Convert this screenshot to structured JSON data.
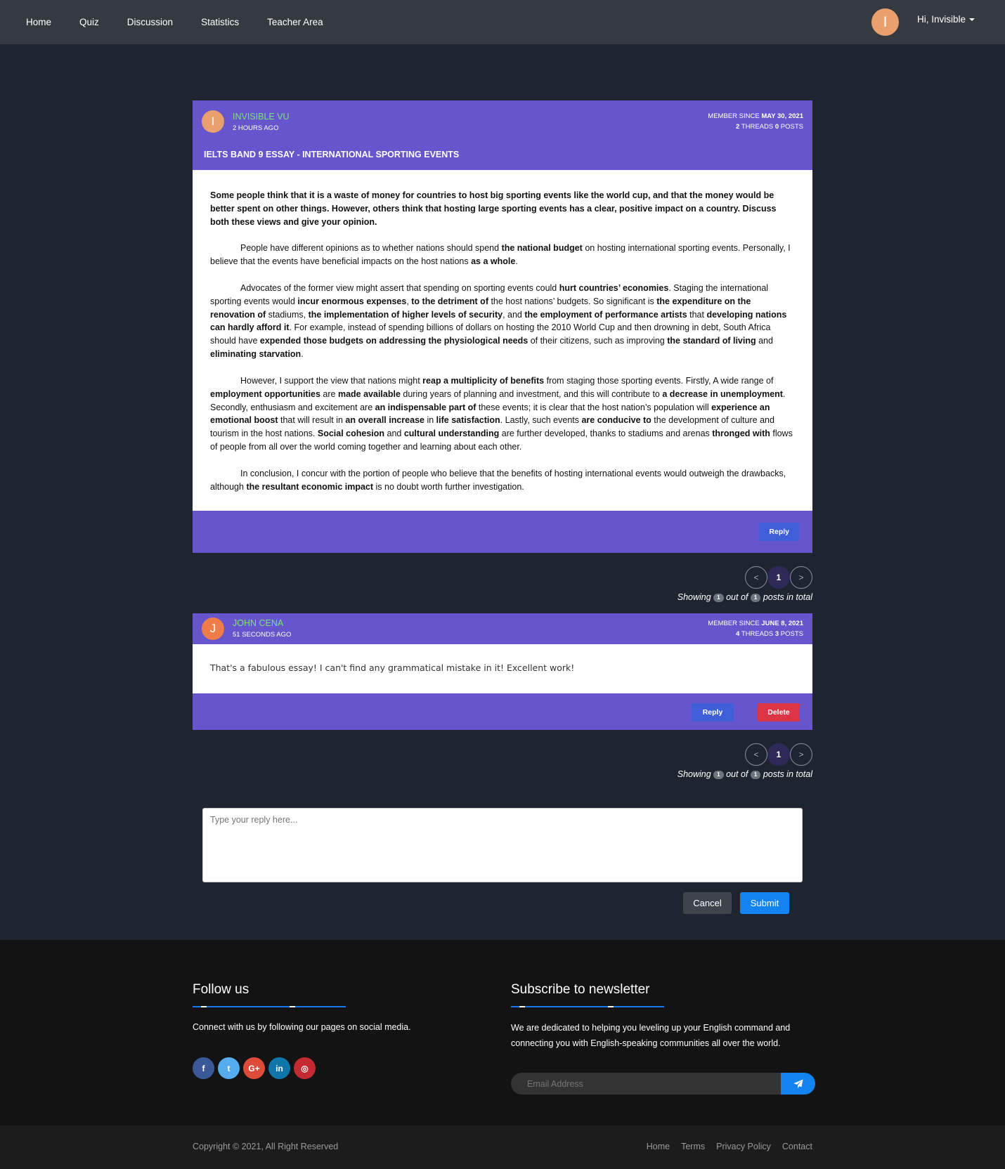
{
  "nav": {
    "links": [
      "Home",
      "Quiz",
      "Discussion",
      "Statistics",
      "Teacher Area"
    ],
    "avatar_letter": "I",
    "user_greeting": "Hi, Invisible"
  },
  "thread": {
    "avatar_letter": "I",
    "author": "INVISIBLE VU",
    "ago": "2 HOURS AGO",
    "member_since_label": "MEMBER SINCE",
    "member_since": "MAY 30, 2021",
    "threads_count": "2",
    "threads_label": "THREADS",
    "posts_count": "0",
    "posts_label": "POSTS",
    "title": "IELTS BAND 9 ESSAY - INTERNATIONAL SPORTING EVENTS",
    "reply_label": "Reply",
    "paragraphs": [
      [
        {
          "b": true,
          "t": "Some people think that it is a waste of money for countries to host big sporting events like the world cup, and that the money would be better spent on other things. However, others think that hosting large sporting events has a clear, positive impact on a country.  Discuss both these views and give your opinion."
        }
      ],
      [
        {
          "t": "People have different opinions as to whether nations should spend "
        },
        {
          "b": true,
          "t": "the national budget"
        },
        {
          "t": " on hosting international sporting events. Personally, I believe that the events have beneficial impacts on the host nations "
        },
        {
          "b": true,
          "t": "as a whole"
        },
        {
          "t": "."
        }
      ],
      [
        {
          "t": "Advocates of the former view might assert that spending on sporting events could "
        },
        {
          "b": true,
          "t": "hurt countries’ economies"
        },
        {
          "t": ". Staging the international sporting events would "
        },
        {
          "b": true,
          "t": "incur enormous expenses"
        },
        {
          "t": ", "
        },
        {
          "b": true,
          "t": "to the detriment of"
        },
        {
          "t": " the host nations’ budgets. So significant is "
        },
        {
          "b": true,
          "t": "the expenditure on the renovation of"
        },
        {
          "t": " stadiums, "
        },
        {
          "b": true,
          "t": "the implementation of higher levels of security"
        },
        {
          "t": ", and "
        },
        {
          "b": true,
          "t": "the employment of performance artists"
        },
        {
          "t": " that "
        },
        {
          "b": true,
          "t": "developing nations can hardly afford it"
        },
        {
          "t": ". For example, instead of spending billions of dollars on hosting the 2010 World Cup and then drowning in debt, South Africa should have "
        },
        {
          "b": true,
          "t": "expended those budgets on addressing the physiological needs"
        },
        {
          "t": " of their citizens, such as improving "
        },
        {
          "b": true,
          "t": "the standard of living"
        },
        {
          "t": " and "
        },
        {
          "b": true,
          "t": "eliminating starvation"
        },
        {
          "t": "."
        }
      ],
      [
        {
          "t": "However, I support the view that nations might "
        },
        {
          "b": true,
          "t": "reap a multiplicity of benefits"
        },
        {
          "t": " from staging those sporting events. Firstly, A wide range of "
        },
        {
          "b": true,
          "t": "employment opportunities"
        },
        {
          "t": " are "
        },
        {
          "b": true,
          "t": "made available"
        },
        {
          "t": " during years of planning and investment, and this will contribute to "
        },
        {
          "b": true,
          "t": "a decrease in unemployment"
        },
        {
          "t": ". Secondly, enthusiasm and excitement are "
        },
        {
          "b": true,
          "t": "an indispensable part of"
        },
        {
          "t": " these events; it is clear that the host nation’s population will "
        },
        {
          "b": true,
          "t": "experience an emotional boost"
        },
        {
          "t": " that will result in "
        },
        {
          "b": true,
          "t": "an overall increase"
        },
        {
          "t": " in "
        },
        {
          "b": true,
          "t": "life satisfaction"
        },
        {
          "t": ". Lastly, such events "
        },
        {
          "b": true,
          "t": "are conducive to"
        },
        {
          "t": " the development of culture and tourism in the host nations. "
        },
        {
          "b": true,
          "t": "Social cohesion"
        },
        {
          "t": " and "
        },
        {
          "b": true,
          "t": "cultural understanding"
        },
        {
          "t": " are further developed, thanks to stadiums and arenas "
        },
        {
          "b": true,
          "t": "thronged with"
        },
        {
          "t": " flows of people from all over the world coming together and learning about each other."
        }
      ],
      [
        {
          "t": "In conclusion, I concur with the portion of people who believe that the benefits of hosting international events would outweigh the drawbacks, although "
        },
        {
          "b": true,
          "t": "the resultant economic impact"
        },
        {
          "t": " is no doubt worth further investigation."
        }
      ]
    ]
  },
  "pagination1": {
    "prev": "<",
    "current": "1",
    "next": ">",
    "showing": "Showing",
    "shown": "1",
    "out_of": "out of",
    "total": "1",
    "suffix": "posts in total"
  },
  "comment": {
    "avatar_letter": "J",
    "author": "JOHN CENA",
    "ago": "51 SECONDS AGO",
    "member_since_label": "MEMBER SINCE",
    "member_since": "JUNE 8, 2021",
    "threads_count": "4",
    "threads_label": "THREADS",
    "posts_count": "3",
    "posts_label": "POSTS",
    "text": "That's a fabulous essay! I can't find any grammatical mistake in it! Excellent work!",
    "reply_label": "Reply",
    "delete_label": "Delete"
  },
  "pagination2": {
    "prev": "<",
    "current": "1",
    "next": ">",
    "showing": "Showing",
    "shown": "1",
    "out_of": "out of",
    "total": "1",
    "suffix": "posts in total"
  },
  "reply_form": {
    "placeholder": "Type your reply here...",
    "cancel": "Cancel",
    "submit": "Submit"
  },
  "footer": {
    "follow_title": "Follow us",
    "follow_text": "Connect with us by following our pages on social media.",
    "socials": [
      {
        "name": "facebook",
        "glyph": "f",
        "color": "#3b5998"
      },
      {
        "name": "twitter",
        "glyph": "t",
        "color": "#55acee"
      },
      {
        "name": "google-plus",
        "glyph": "G+",
        "color": "#dd4b39"
      },
      {
        "name": "linkedin",
        "glyph": "in",
        "color": "#0e76a8"
      },
      {
        "name": "instagram",
        "glyph": "◎",
        "color": "#c32a32"
      }
    ],
    "newsletter_title": "Subscribe to newsletter",
    "newsletter_text": "We are dedicated to helping you leveling up your English command and connecting you with English-speaking communities all over the world.",
    "email_placeholder": "Email Address",
    "copyright": "Copyright © 2021, All Right Reserved",
    "links": [
      "Home",
      "Terms",
      "Privacy Policy",
      "Contact"
    ]
  },
  "colors": {
    "nav_bg": "#343a40",
    "page_bg": "#1f2431",
    "card_accent": "#6655cc",
    "author_green": "#7de07a",
    "primary": "#1483f2",
    "danger": "#dc3545"
  }
}
